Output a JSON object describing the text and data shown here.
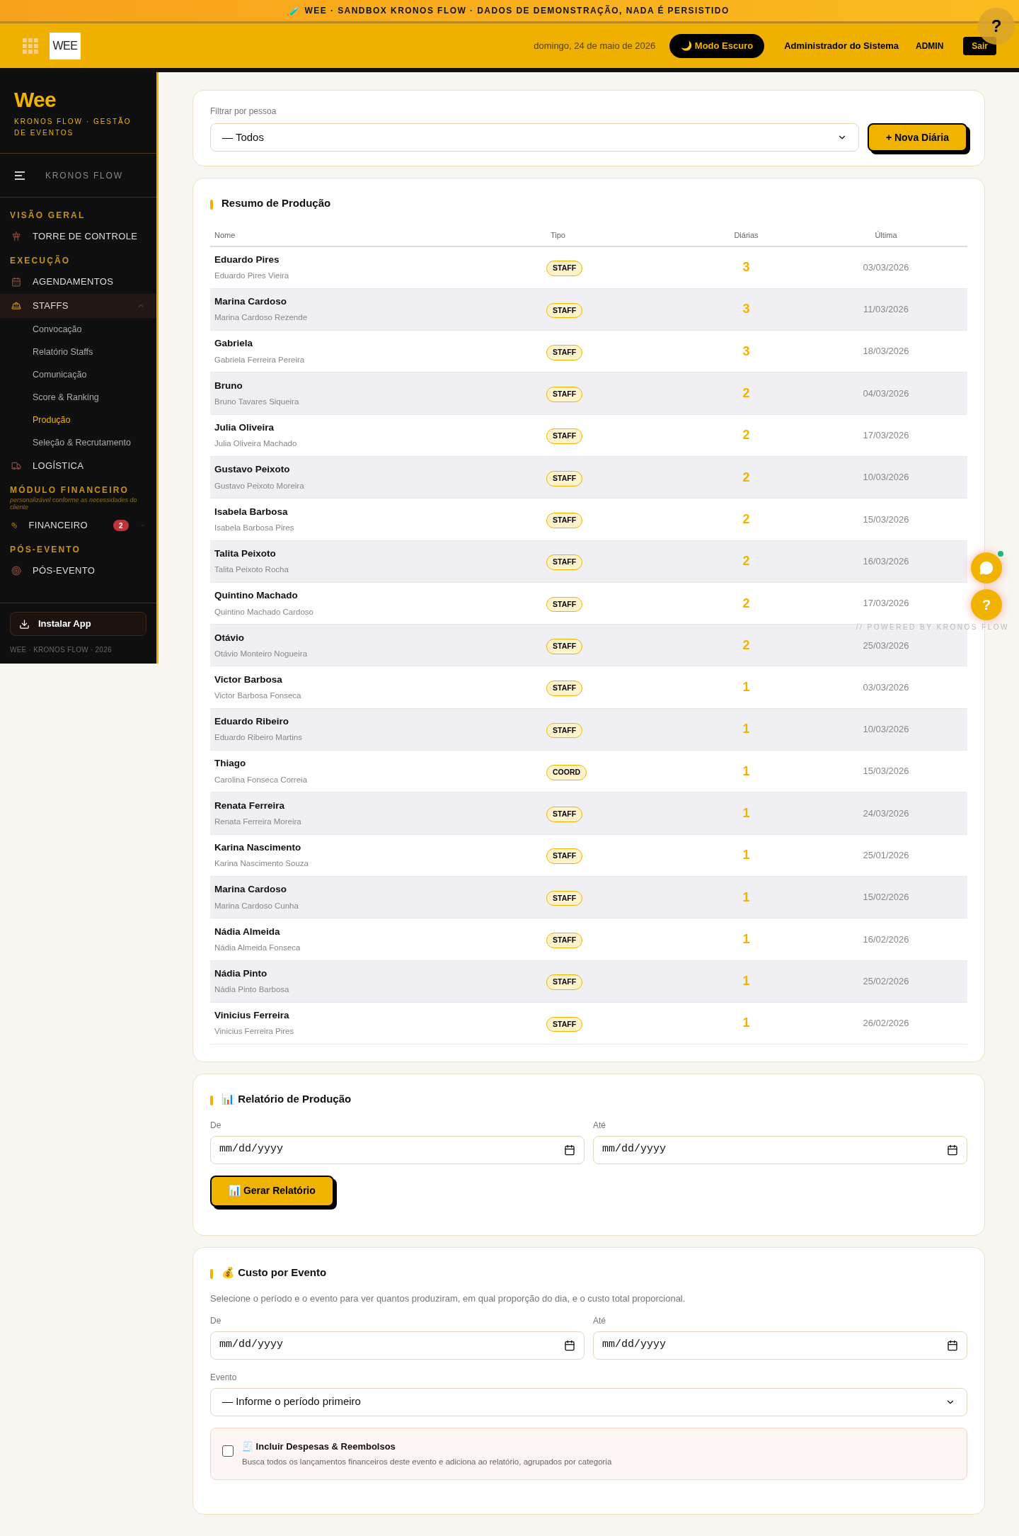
{
  "banner": "🧪 WEE · SANDBOX KRONOS FLOW · DADOS DE DEMONSTRAÇÃO, NADA É PERSISTIDO",
  "header": {
    "logo": "WEE",
    "date": "domingo, 24 de maio de 2026",
    "dark_mode_button": "🌙 Modo Escuro",
    "user": "Administrador do Sistema",
    "role": "ADMIN",
    "logout": "Sair",
    "help": "?"
  },
  "sidebar": {
    "brand": "Wee",
    "tagline": "KRONOS FLOW · GESTÃO DE EVENTOS",
    "menu_label": "KRONOS FLOW",
    "sections": [
      {
        "title": "VISÃO GERAL",
        "items": [
          {
            "kind": "link",
            "label": "TORRE DE CONTROLE"
          }
        ]
      },
      {
        "title": "EXECUÇÃO",
        "items": [
          {
            "kind": "link",
            "label": "AGENDAMENTOS"
          },
          {
            "kind": "group",
            "label": "STAFFS",
            "expanded": true,
            "children": [
              {
                "label": "Convocação",
                "selected": false
              },
              {
                "label": "Relatório Staffs",
                "selected": false
              },
              {
                "label": "Comunicação",
                "selected": false
              },
              {
                "label": "Score & Ranking",
                "selected": false
              },
              {
                "label": "Produção",
                "selected": true
              },
              {
                "label": "Seleção & Recrutamento",
                "selected": false
              }
            ]
          },
          {
            "kind": "link",
            "label": "LOGÍSTICA"
          }
        ]
      },
      {
        "title": "MÓDULO FINANCEIRO",
        "note": "personalizável conforme as necessidades do cliente",
        "items": [
          {
            "kind": "group",
            "label": "FINANCEIRO",
            "badge": "2",
            "expanded": false
          }
        ]
      },
      {
        "title": "PÓS-EVENTO",
        "items": [
          {
            "kind": "link",
            "label": "PÓS-EVENTO"
          }
        ]
      }
    ],
    "install_button": "Instalar App",
    "footer": "WEE · KRONOS FLOW · 2026"
  },
  "filter": {
    "label": "Filtrar por pessoa",
    "value": "— Todos",
    "new_button": "+ Nova Diária"
  },
  "summary": {
    "title": "Resumo de Produção",
    "columns": [
      "Nome",
      "Tipo",
      "Diárias",
      "Última"
    ],
    "rows": [
      {
        "name": "Eduardo Pires",
        "full_name": "Eduardo Pires Vieira",
        "type": "STAFF",
        "count": "3",
        "last": "03/03/2026"
      },
      {
        "name": "Marina Cardoso",
        "full_name": "Marina Cardoso Rezende",
        "type": "STAFF",
        "count": "3",
        "last": "11/03/2026"
      },
      {
        "name": "Gabriela",
        "full_name": "Gabriela Ferreira Pereira",
        "type": "STAFF",
        "count": "3",
        "last": "18/03/2026"
      },
      {
        "name": "Bruno",
        "full_name": "Bruno Tavares Siqueira",
        "type": "STAFF",
        "count": "2",
        "last": "04/03/2026"
      },
      {
        "name": "Julia Oliveira",
        "full_name": "Julia Oliveira Machado",
        "type": "STAFF",
        "count": "2",
        "last": "17/03/2026"
      },
      {
        "name": "Gustavo Peixoto",
        "full_name": "Gustavo Peixoto Moreira",
        "type": "STAFF",
        "count": "2",
        "last": "10/03/2026"
      },
      {
        "name": "Isabela Barbosa",
        "full_name": "Isabela Barbosa Pires",
        "type": "STAFF",
        "count": "2",
        "last": "15/03/2026"
      },
      {
        "name": "Talita Peixoto",
        "full_name": "Talita Peixoto Rocha",
        "type": "STAFF",
        "count": "2",
        "last": "16/03/2026"
      },
      {
        "name": "Quintino Machado",
        "full_name": "Quintino Machado Cardoso",
        "type": "STAFF",
        "count": "2",
        "last": "17/03/2026"
      },
      {
        "name": "Otávio",
        "full_name": "Otávio Monteiro Nogueira",
        "type": "STAFF",
        "count": "2",
        "last": "25/03/2026"
      },
      {
        "name": "Victor Barbosa",
        "full_name": "Victor Barbosa Fonseca",
        "type": "STAFF",
        "count": "1",
        "last": "03/03/2026"
      },
      {
        "name": "Eduardo Ribeiro",
        "full_name": "Eduardo Ribeiro Martins",
        "type": "STAFF",
        "count": "1",
        "last": "10/03/2026"
      },
      {
        "name": "Thiago",
        "full_name": "Carolina Fonseca Correia",
        "type": "COORD",
        "count": "1",
        "last": "15/03/2026"
      },
      {
        "name": "Renata Ferreira",
        "full_name": "Renata Ferreira Moreira",
        "type": "STAFF",
        "count": "1",
        "last": "24/03/2026"
      },
      {
        "name": "Karina Nascimento",
        "full_name": "Karina Nascimento Souza",
        "type": "STAFF",
        "count": "1",
        "last": "25/01/2026"
      },
      {
        "name": "Marina Cardoso",
        "full_name": "Marina Cardoso Cunha",
        "type": "STAFF",
        "count": "1",
        "last": "15/02/2026"
      },
      {
        "name": "Nádia Almeida",
        "full_name": "Nádia Almeida Fonseca",
        "type": "STAFF",
        "count": "1",
        "last": "16/02/2026"
      },
      {
        "name": "Nádia Pinto",
        "full_name": "Nádia Pinto Barbosa",
        "type": "STAFF",
        "count": "1",
        "last": "25/02/2026"
      },
      {
        "name": "Vinicius Ferreira",
        "full_name": "Vinicius Ferreira Pires",
        "type": "STAFF",
        "count": "1",
        "last": "26/02/2026"
      }
    ]
  },
  "report": {
    "title": "📊 Relatório de Produção",
    "from_label": "De",
    "from_placeholder": "mm/dd/yyyy",
    "to_label": "Até",
    "to_placeholder": "mm/dd/yyyy",
    "button": "📊 Gerar Relatório"
  },
  "cost": {
    "title": "💰 Custo por Evento",
    "description": "Selecione o período e o evento para ver quantos produziram, em qual proporção do dia, e o custo total proporcional.",
    "from_label": "De",
    "from_placeholder": "mm/dd/yyyy",
    "to_label": "Até",
    "to_placeholder": "mm/dd/yyyy",
    "event_label": "Evento",
    "event_value": "— Informe o período primeiro",
    "expenses": {
      "label": "🧾 Incluir Despesas & Reembolsos",
      "hint": "Busca todos os lançamentos financeiros deste evento e adiciona ao relatório, agrupados por categoria",
      "checked": false
    }
  },
  "floating": {
    "help": "?",
    "powered": "// POWERED BY KRONOS FLOW"
  }
}
